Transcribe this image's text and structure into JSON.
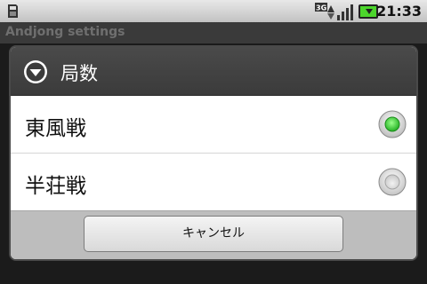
{
  "status_bar": {
    "time": "21:33",
    "icons": [
      "sd-card-icon",
      "3g-icon",
      "signal-icon",
      "battery-icon"
    ]
  },
  "app": {
    "title": "Andjong settings"
  },
  "dialog": {
    "title": "局数",
    "options": [
      {
        "label": "東風戦",
        "selected": true
      },
      {
        "label": "半荘戦",
        "selected": false
      }
    ],
    "cancel_label": "キャンセル"
  },
  "colors": {
    "radio_selected": "#33cc33",
    "header_bg": "#3b3b3b",
    "footer_bg": "#bdbdbd"
  }
}
